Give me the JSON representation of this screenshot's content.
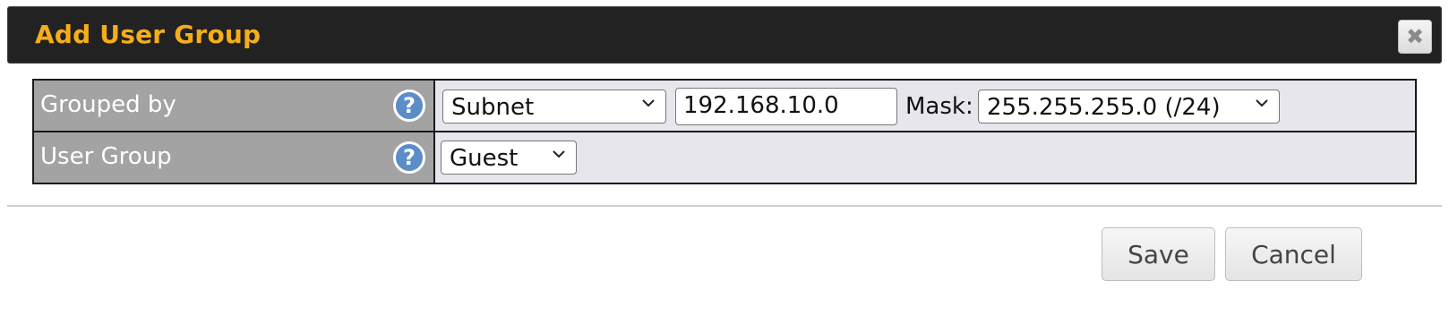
{
  "dialog": {
    "title": "Add User Group",
    "close_icon": "close-icon"
  },
  "form": {
    "grouped_by": {
      "label": "Grouped by",
      "help_icon": "help-icon",
      "type_select": "Subnet",
      "ip_value": "192.168.10.0",
      "mask_label": "Mask:",
      "mask_select": "255.255.255.0 (/24)"
    },
    "user_group": {
      "label": "User Group",
      "help_icon": "help-icon",
      "select": "Guest"
    }
  },
  "footer": {
    "save_label": "Save",
    "cancel_label": "Cancel"
  },
  "colors": {
    "title": "#f5ad1a",
    "titlebar_bg": "#222222",
    "label_bg": "#a3a3a3",
    "field_bg": "#e6e6ec",
    "help_icon": "#5b8dc9"
  }
}
